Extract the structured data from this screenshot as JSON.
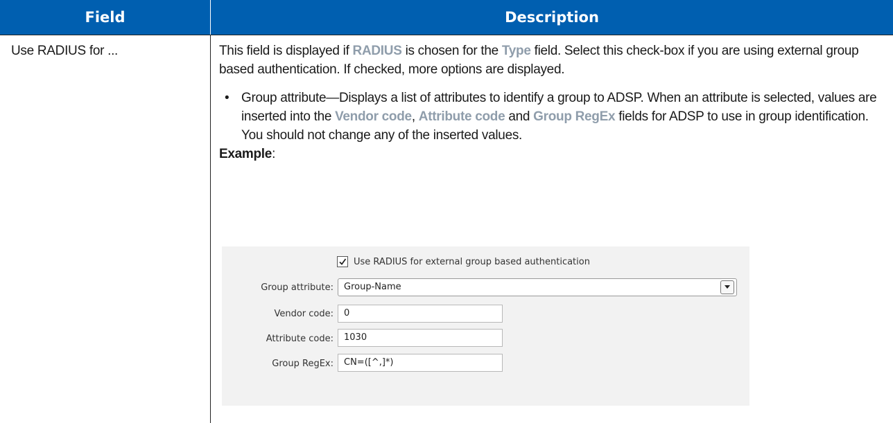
{
  "table": {
    "headers": {
      "field": "Field",
      "description": "Description"
    },
    "row": {
      "field": "Use RADIUS for ...",
      "description": {
        "p1_a": "This field is displayed if ",
        "p1_kw1": "RADIUS",
        "p1_b": " is chosen for the ",
        "p1_kw2": "Type",
        "p1_c": " field. Select this check-box if you are using external group based authentication. If checked, more options are displayed.",
        "bullet_a": "Group attribute—Displays a list of attributes to identify a group to ADSP. When an attribute is selected, values are inserted into the ",
        "bullet_kw1": "Vendor code",
        "bullet_b": ", ",
        "bullet_kw2": "Attribute code",
        "bullet_c": " and ",
        "bullet_kw3": "Group RegEx",
        "bullet_d": " fields for ADSP to use in group identification. You should not change any of the inserted values.",
        "example_label": "Example",
        "example_colon": ":"
      }
    }
  },
  "example_screenshot": {
    "checkbox_label": "Use RADIUS for external group based authentication",
    "checkbox_checked": true,
    "group_attribute_label": "Group attribute:",
    "group_attribute_value": "Group-Name",
    "vendor_code_label": "Vendor code:",
    "vendor_code_value": "0",
    "attribute_code_label": "Attribute code:",
    "attribute_code_value": "1030",
    "group_regex_label": "Group RegEx:",
    "group_regex_value": "CN=([^,]*)"
  },
  "colors": {
    "header_bg": "#005fb0",
    "keyword": "#8f9dab"
  }
}
